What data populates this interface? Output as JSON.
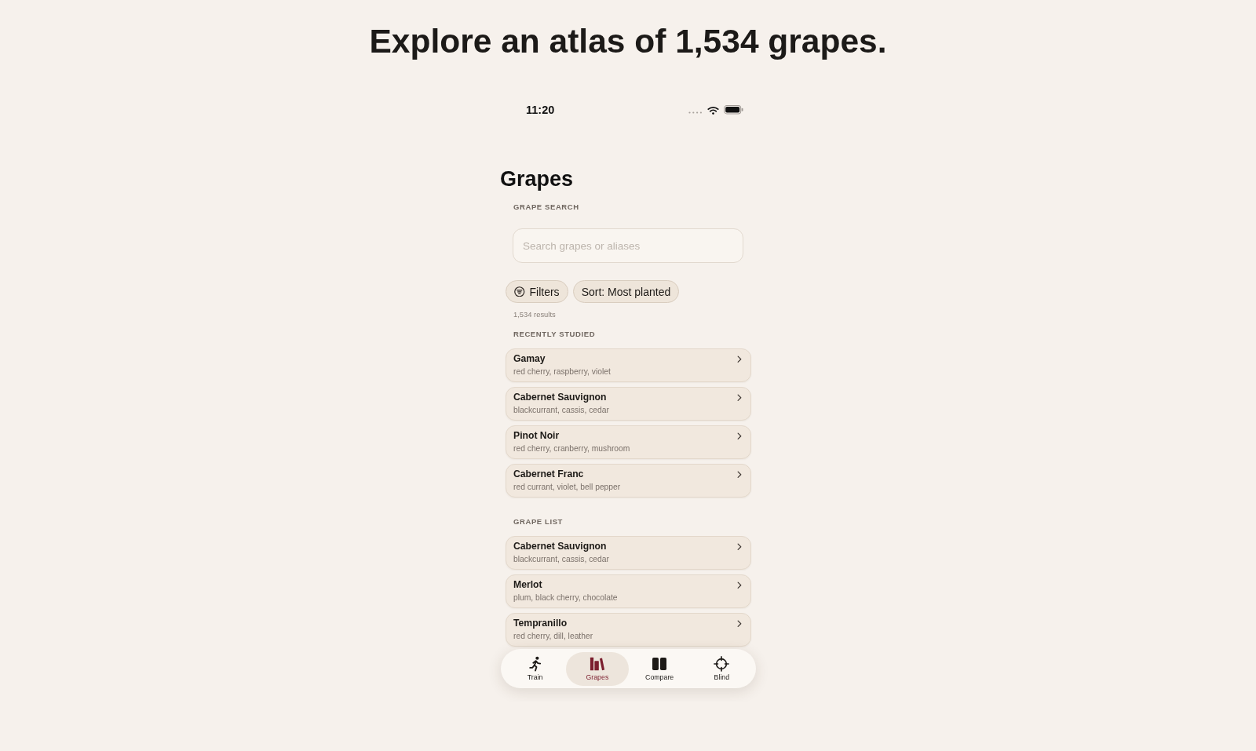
{
  "headline": "Explore an atlas of 1,534 grapes.",
  "status_bar": {
    "time": "11:20"
  },
  "screen_title": "Grapes",
  "search": {
    "label": "GRAPE SEARCH",
    "placeholder": "Search grapes or aliases"
  },
  "chips": [
    {
      "label": "Filters",
      "kind": "filter"
    },
    {
      "label": "Sort: Most planted",
      "kind": "sort"
    }
  ],
  "result_count": "1,534 results",
  "sections": [
    {
      "title": "RECENTLY STUDIED",
      "items": [
        {
          "name": "Gamay",
          "notes": "red cherry, raspberry, violet"
        },
        {
          "name": "Cabernet Sauvignon",
          "notes": "blackcurrant, cassis, cedar"
        },
        {
          "name": "Pinot Noir",
          "notes": "red cherry, cranberry, mushroom"
        },
        {
          "name": "Cabernet Franc",
          "notes": "red currant, violet, bell pepper"
        }
      ]
    },
    {
      "title": "GRAPE LIST",
      "items": [
        {
          "name": "Cabernet Sauvignon",
          "notes": "blackcurrant, cassis, cedar"
        },
        {
          "name": "Merlot",
          "notes": "plum, black cherry, chocolate"
        },
        {
          "name": "Tempranillo",
          "notes": "red cherry, dill, leather"
        }
      ]
    }
  ],
  "tab_bar": [
    {
      "label": "Train",
      "selected": false
    },
    {
      "label": "Grapes",
      "selected": true
    },
    {
      "label": "Compare",
      "selected": false
    },
    {
      "label": "Blind",
      "selected": false
    }
  ]
}
